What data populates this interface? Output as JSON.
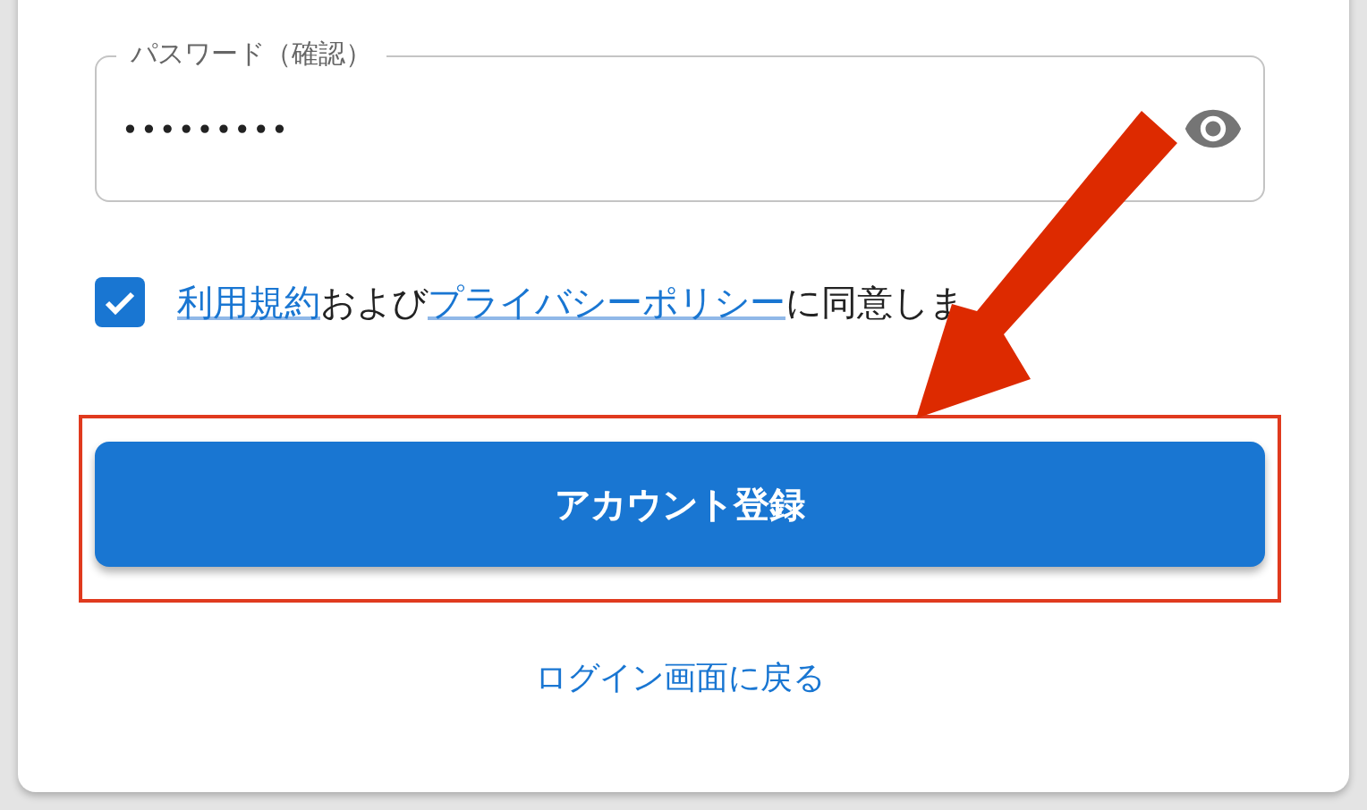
{
  "password_confirm": {
    "label": "パスワード（確認）",
    "value": "•••••••••"
  },
  "agreement": {
    "checked": true,
    "parts": [
      {
        "kind": "link",
        "text": "利用規約"
      },
      {
        "kind": "text",
        "text": "および"
      },
      {
        "kind": "link",
        "text": "プライバシーポリシー"
      },
      {
        "kind": "text",
        "text": "に同意しま"
      }
    ]
  },
  "submit_button": {
    "label": "アカウント登録"
  },
  "back_link": {
    "label": "ログイン画面に戻る"
  }
}
